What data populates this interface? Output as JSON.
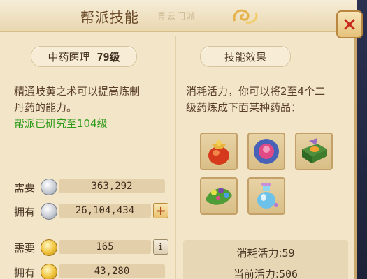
{
  "window": {
    "title": "帮派技能",
    "title_decoration": "青云门派",
    "close_symbol": "×",
    "colors": {
      "panel": "#f3e6c8",
      "accent_green": "#2e9a1a",
      "close_x": "#c8281e"
    }
  },
  "skill": {
    "name": "中药医理",
    "level": "79级",
    "description_line1": "精通岐黄之术可以提高炼制",
    "description_line2": "丹药的能力。",
    "research_status": "帮派已研究至104级"
  },
  "costs": {
    "silver_required_label": "需要",
    "silver_required_value": "363,292",
    "silver_owned_label": "拥有",
    "silver_owned_value": "26,104,434",
    "gold_required_label": "需要",
    "gold_required_value": "165",
    "gold_owned_label": "拥有",
    "gold_owned_value": "43,280",
    "plus_symbol": "+",
    "info_symbol": "i"
  },
  "effect": {
    "header": "技能效果",
    "description_line1": "消耗活力，你可以将2至4个二",
    "description_line2": "级药炼成下面某种药品：",
    "items": [
      {
        "icon": "pouch-icon"
      },
      {
        "icon": "blue-ring-icon"
      },
      {
        "icon": "box-icon"
      },
      {
        "icon": "leaf-beads-icon"
      },
      {
        "icon": "potion-bottle-icon"
      }
    ],
    "vitality_cost_label": "消耗活力:",
    "vitality_cost_value": "59",
    "vitality_current_label": "当前活力:",
    "vitality_current_value": "506"
  }
}
